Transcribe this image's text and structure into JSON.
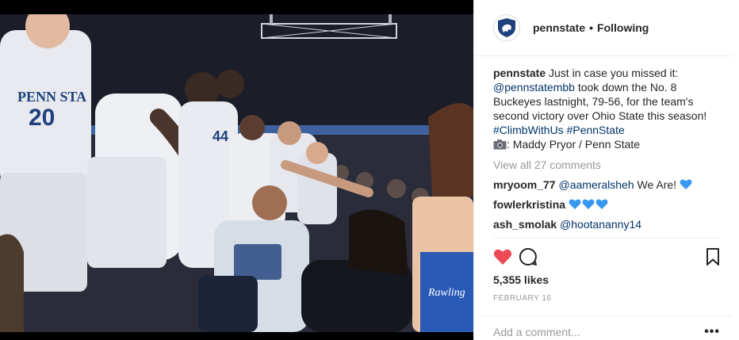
{
  "post": {
    "photo_alt": "",
    "account": {
      "username": "pennstate",
      "separator": "•",
      "follow_status": "Following"
    },
    "caption": {
      "username": "pennstate",
      "text_1": "Just in case you missed it:",
      "mention": "@pennstatembb",
      "text_2": "took down the No. 8 Buckeyes lastnight, 79-56, for the team's second victory over Ohio State this season!",
      "hashtag_1": "#ClimbWithUs",
      "hashtag_2": "#PennState",
      "credit": ": Maddy Pryor / Penn State"
    },
    "view_all_comments": "View all 27 comments",
    "comments": [
      {
        "username": "mryoom_77",
        "mention": "@aameralsheh",
        "text": "We Are!"
      },
      {
        "username": "fowlerkristina",
        "text": ""
      },
      {
        "username": "ash_smolak",
        "mention": "@hootananny14",
        "text": ""
      }
    ],
    "likes": "5,355 likes",
    "date": "FEBRUARY 16",
    "add_comment_placeholder": "Add a comment...",
    "more_label": "•••"
  },
  "colors": {
    "like": "#ed4956",
    "blue_heart": "#3897f0",
    "link": "#003569",
    "penn_state_navy": "#1e407c"
  },
  "icons": {
    "avatar": "penn-state-shield-logo",
    "like": "heart-filled-icon",
    "comment": "speech-bubble-icon",
    "save": "bookmark-icon",
    "camera": "camera-icon",
    "blue_heart": "blue-heart-emoji"
  }
}
